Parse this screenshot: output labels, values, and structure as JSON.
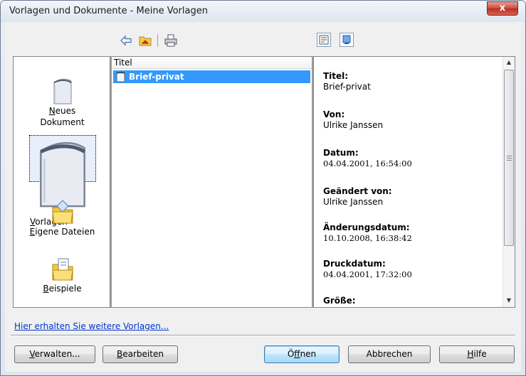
{
  "window": {
    "title": "Vorlagen und Dokumente - Meine Vorlagen",
    "close_glyph": "x"
  },
  "toolbar": {
    "icons": [
      "back-arrow-icon",
      "folder-up-icon",
      "print-icon"
    ],
    "view_buttons": [
      "preview-list-icon",
      "document-preview-icon"
    ]
  },
  "categories": [
    {
      "line1": "Neues",
      "line2": "Dokument",
      "mnemonic": "N",
      "icon": "new-document-icon",
      "selected": false
    },
    {
      "line1": "Vorlagen",
      "mnemonic": "V",
      "icon": "templates-icon",
      "selected": true
    },
    {
      "line1": "Eigene Dateien",
      "mnemonic": "E",
      "icon": "folder-icon",
      "selected": false
    },
    {
      "line1": "Beispiele",
      "mnemonic": "B",
      "icon": "examples-folder-icon",
      "selected": false
    }
  ],
  "list": {
    "column_header": "Titel",
    "rows": [
      {
        "label": "Brief-privat",
        "icon": "template-file-icon",
        "selected": true
      }
    ]
  },
  "info": [
    {
      "label": "Titel:",
      "value": "Brief-privat"
    },
    {
      "label": "Von:",
      "value": "Ulrike Janssen"
    },
    {
      "label": "Datum:",
      "value": "04.04.2001, 16:54:00"
    },
    {
      "label": "Geändert von:",
      "value": "Ulrike Janssen"
    },
    {
      "label": "Änderungsdatum:",
      "value": "10.10.2008, 16:38:42"
    },
    {
      "label": "Druckdatum:",
      "value": "04.04.2001, 17:32:00"
    },
    {
      "label": "Größe:",
      "value": ""
    }
  ],
  "footer_link": "Hier erhalten Sie weitere Vorlagen...",
  "buttons": {
    "verwalten": {
      "pre": "",
      "mn": "V",
      "post": "erwalten..."
    },
    "bearbeiten": {
      "pre": "",
      "mn": "B",
      "post": "earbeiten"
    },
    "oeffnen": {
      "pre": "Ö",
      "mn": "f",
      "post": "fnen"
    },
    "abbrechen": {
      "label": "Abbrechen"
    },
    "hilfe": {
      "pre": "",
      "mn": "H",
      "post": "ilfe"
    }
  },
  "colors": {
    "selection": "#3399ff",
    "link": "#0033cc",
    "close_button": "#c9473a"
  }
}
